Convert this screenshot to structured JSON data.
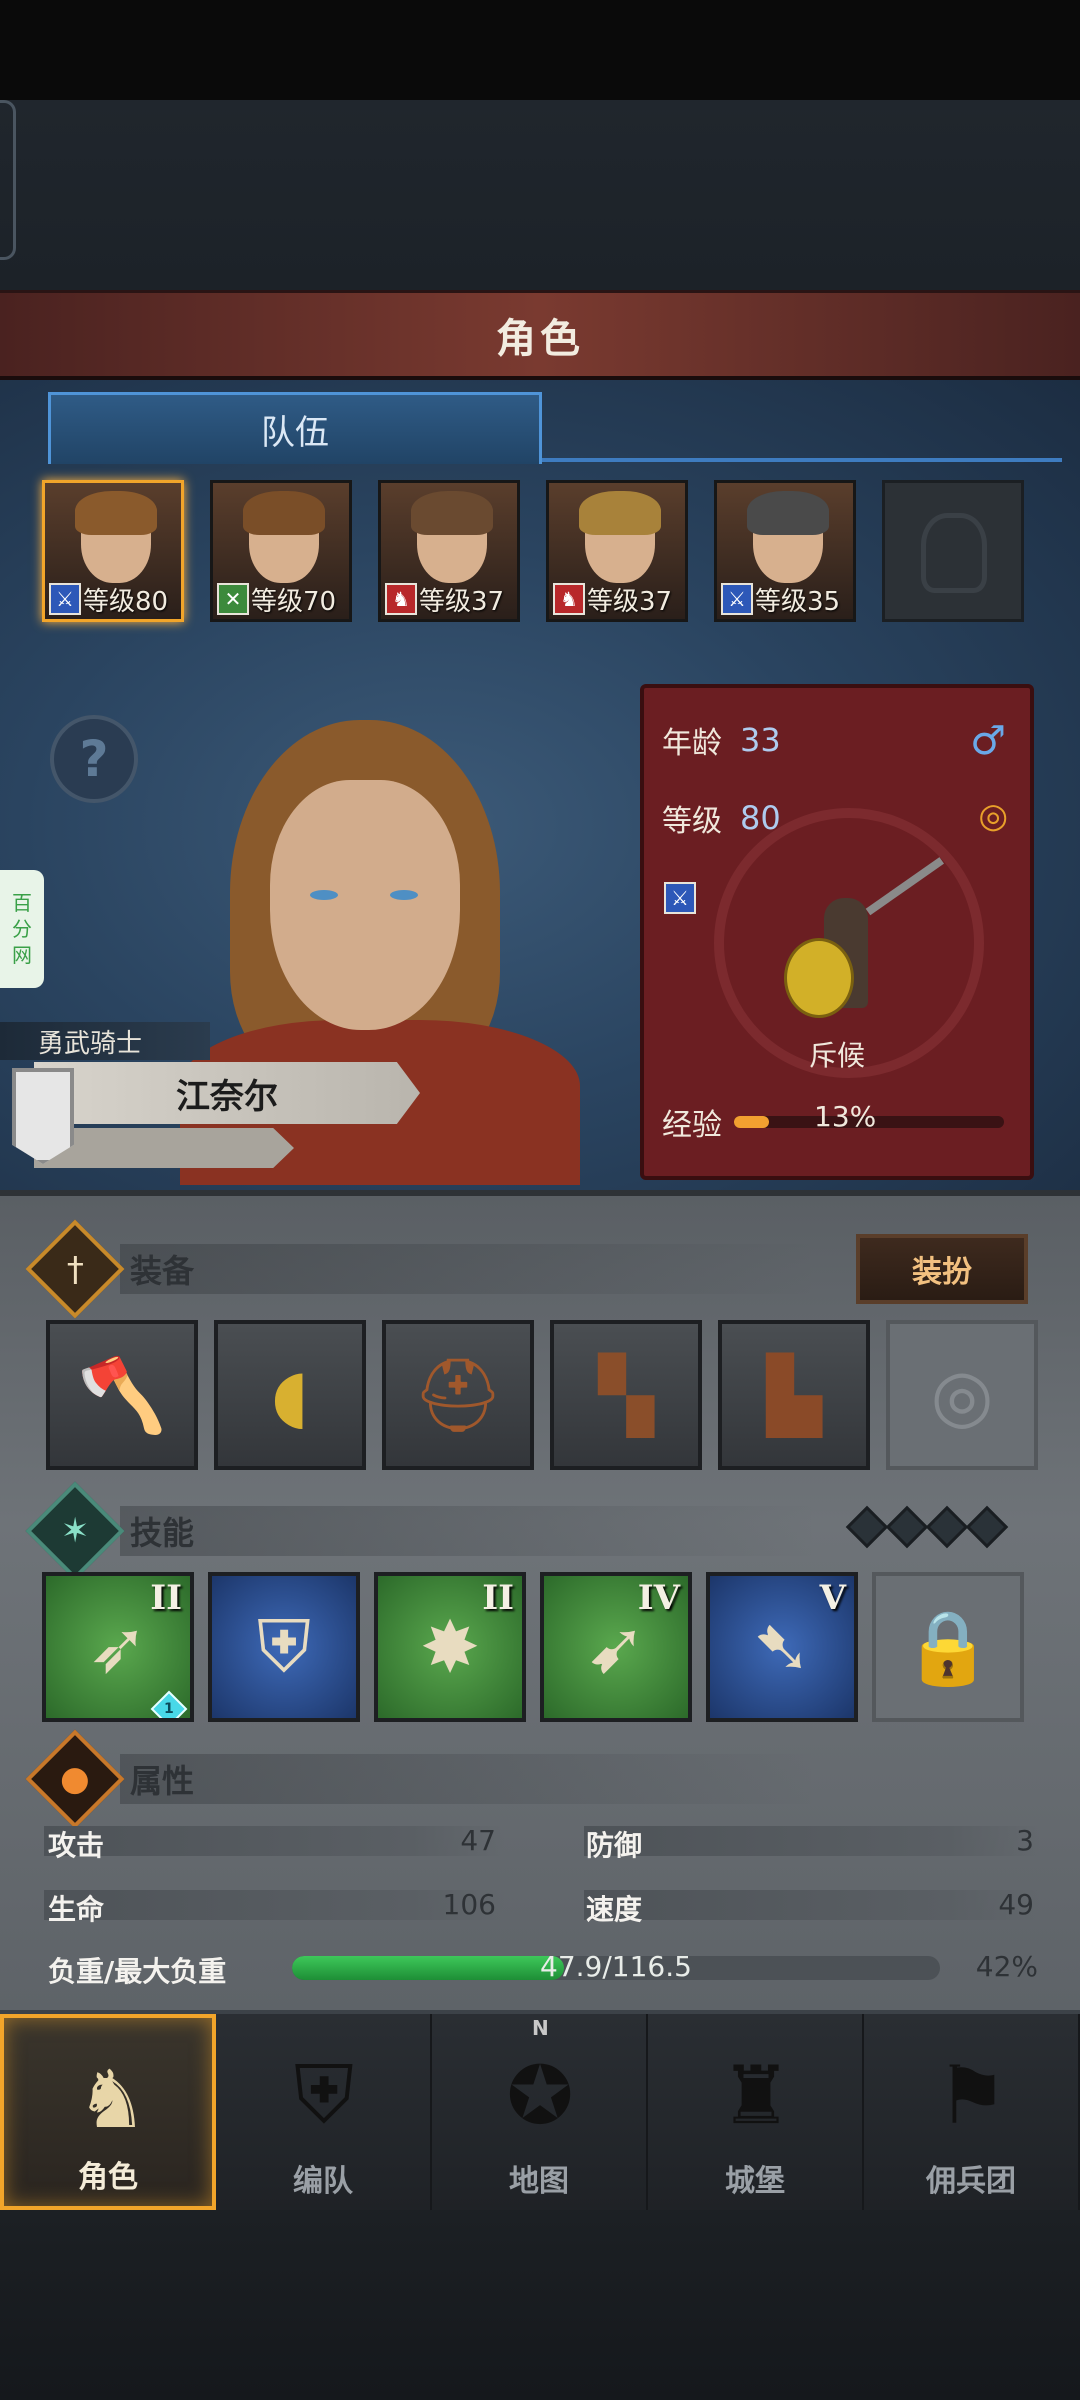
{
  "screen_title": "角色",
  "team_tab": "队伍",
  "roster": [
    {
      "class_icon": "sword-icon",
      "class_color": "#2d58b8",
      "level_text": "等级80",
      "hair": "#8a5a2c",
      "selected": true
    },
    {
      "class_icon": "crossed-swords-icon",
      "class_color": "#3c8a3c",
      "level_text": "等级70",
      "hair": "#7a4e28",
      "selected": false
    },
    {
      "class_icon": "horse-icon",
      "class_color": "#b8282a",
      "level_text": "等级37",
      "hair": "#6a4a30",
      "selected": false
    },
    {
      "class_icon": "horse-icon",
      "class_color": "#b8282a",
      "level_text": "等级37",
      "hair": "#a8823a",
      "selected": false
    },
    {
      "class_icon": "sword-icon",
      "class_color": "#2d58b8",
      "level_text": "等级35",
      "hair": "#4a4a4a",
      "selected": false
    }
  ],
  "hero": {
    "title": "勇武骑士",
    "name": "江奈尔"
  },
  "watermark": [
    "百",
    "分",
    "网"
  ],
  "info_card": {
    "age_label": "年龄",
    "age_value": "33",
    "level_label": "等级",
    "level_value": "80",
    "unit_name": "斥候",
    "exp_label": "经验",
    "exp_text": "13%",
    "exp_fraction": 0.13
  },
  "equipment": {
    "title": "装备",
    "dress_button": "装扮",
    "slots": [
      {
        "icon": "axe-icon",
        "glyph": "🪓"
      },
      {
        "icon": "shield-icon",
        "glyph": "◖"
      },
      {
        "icon": "helmet-icon",
        "glyph": "⛑"
      },
      {
        "icon": "armor-icon",
        "glyph": "▚"
      },
      {
        "icon": "boots-icon",
        "glyph": "▙"
      },
      {
        "icon": "ring-slot-icon",
        "glyph": "◎"
      }
    ]
  },
  "skills": {
    "title": "技能",
    "slots": [
      {
        "icon": "slash-skill-icon",
        "rank": "II",
        "bg": "green",
        "gem": "1"
      },
      {
        "icon": "shield-bash-skill-icon",
        "rank": "",
        "bg": "blue",
        "gem": ""
      },
      {
        "icon": "crystal-burst-skill-icon",
        "rank": "II",
        "bg": "green",
        "gem": ""
      },
      {
        "icon": "dash-skill-icon",
        "rank": "IV",
        "bg": "green",
        "gem": ""
      },
      {
        "icon": "charge-skill-icon",
        "rank": "V",
        "bg": "blue",
        "gem": ""
      }
    ]
  },
  "attributes": {
    "title": "属性",
    "attack_label": "攻击",
    "attack_value": "47",
    "defense_label": "防御",
    "defense_value": "3",
    "hp_label": "生命",
    "hp_value": "106",
    "speed_label": "速度",
    "speed_value": "49",
    "load_label": "负重/最大负重",
    "load_text": "47.9/116.5",
    "load_pct": "42%",
    "load_fraction": 0.42
  },
  "nav": [
    {
      "label": "角色",
      "icon": "knight-icon",
      "active": true
    },
    {
      "label": "编队",
      "icon": "formation-icon",
      "active": false
    },
    {
      "label": "地图",
      "icon": "compass-map-icon",
      "active": false
    },
    {
      "label": "城堡",
      "icon": "castle-icon",
      "active": false
    },
    {
      "label": "佣兵团",
      "icon": "mercenary-banner-icon",
      "active": false
    }
  ],
  "compass_letter": "N"
}
